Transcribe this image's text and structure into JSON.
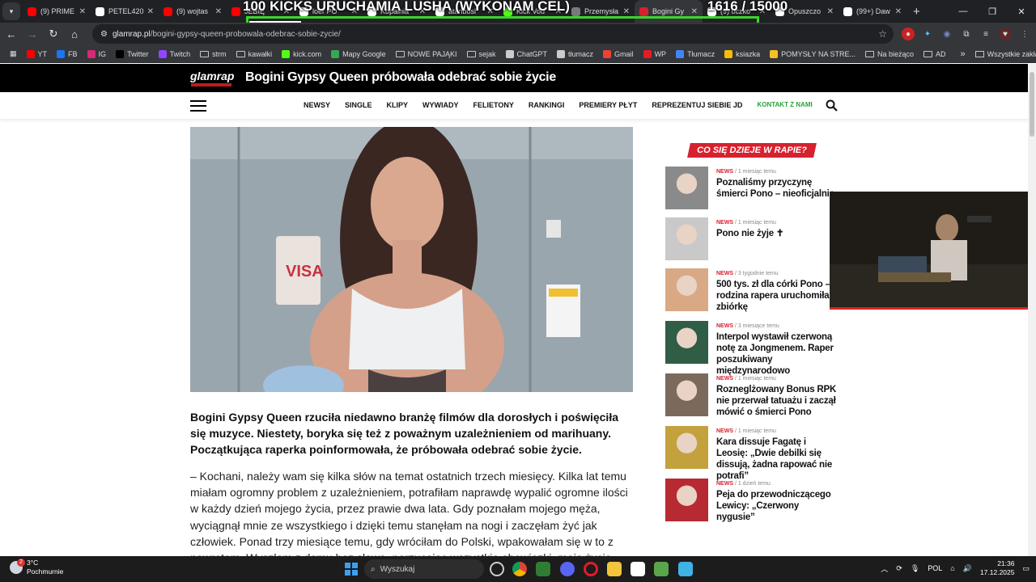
{
  "browser": {
    "tabs": [
      {
        "label": "(9) PRIME",
        "color": "#ff0000"
      },
      {
        "label": "PETEL420",
        "color": "#ffffff"
      },
      {
        "label": "(9) wojtas",
        "color": "#ff0000"
      },
      {
        "label": "JEBIĘ",
        "color": "#ff0000"
      },
      {
        "label": "loer PO",
        "color": "#ffffff"
      },
      {
        "label": "Kopalnia",
        "color": "#ffffff"
      },
      {
        "label": "atanbosl",
        "color": "#ffffff"
      },
      {
        "label": "Kick Vod",
        "color": "#53fc18"
      },
      {
        "label": "Przemysła",
        "color": "#7a7a7a"
      },
      {
        "label": "Bogini Gy",
        "color": "#d6212f",
        "active": true
      },
      {
        "label": "(9) oczko",
        "color": "#ffffff"
      },
      {
        "label": "Opuszczo",
        "color": "#ffffff"
      },
      {
        "label": "(99+) Daw",
        "color": "#ffffff"
      }
    ],
    "overlay_text_left": "100 KICKS URUCHAMIA LUSHA (WYKONAM CEL)",
    "overlay_text_right": "1616  / 15000",
    "url_host": "glamrap.pl",
    "url_path": "/bogini-gypsy-queen-probowala-odebrac-sobie-zycie/",
    "bookmarks": [
      {
        "label": "YT",
        "color": "#ff0000",
        "type": "icon"
      },
      {
        "label": "FB",
        "color": "#1877f2",
        "type": "icon"
      },
      {
        "label": "IG",
        "color": "#d62976",
        "type": "icon"
      },
      {
        "label": "Twitter",
        "color": "#000000",
        "type": "icon"
      },
      {
        "label": "Twitch",
        "color": "#9146ff",
        "type": "icon"
      },
      {
        "label": "strm",
        "type": "folder"
      },
      {
        "label": "kawałki",
        "type": "folder"
      },
      {
        "label": "kick.com",
        "color": "#53fc18",
        "type": "icon"
      },
      {
        "label": "Mapy Google",
        "color": "#34a853",
        "type": "icon"
      },
      {
        "label": "NOWE PAJĄKI",
        "type": "folder"
      },
      {
        "label": "sejak",
        "type": "folder"
      },
      {
        "label": "ChatGPT",
        "color": "#cccccc",
        "type": "icon"
      },
      {
        "label": "tłumacz",
        "color": "#cccccc",
        "type": "icon"
      },
      {
        "label": "Gmail",
        "color": "#ea4335",
        "type": "icon"
      },
      {
        "label": "WP",
        "color": "#e31b23",
        "type": "icon"
      },
      {
        "label": "Tłumacz",
        "color": "#4285f4",
        "type": "icon"
      },
      {
        "label": "ksiazka",
        "color": "#fbbc05",
        "type": "icon"
      },
      {
        "label": "POMYSŁY NA STRE...",
        "color": "#f6c026",
        "type": "icon"
      },
      {
        "label": "Na bieżąco",
        "type": "folder"
      },
      {
        "label": "AD",
        "type": "folder"
      }
    ],
    "bookmarks_other": "Wszystkie zakładki"
  },
  "site": {
    "logo": "glamrap",
    "headline": "Bogini Gypsy Queen próbowała odebrać sobie życie",
    "nav": [
      "NEWSY",
      "SINGLE",
      "KLIPY",
      "WYWIADY",
      "FELIETONY",
      "RANKINGI",
      "PREMIERY PŁYT",
      "REPREZENTUJ SIEBIE JD"
    ],
    "nav_contact": "KONTAKT Z NAMI",
    "lead": "Bogini Gypsy Queen rzuciła niedawno branżę filmów dla dorosłych i poświęciła się muzyce. Niestety, boryka się też z poważnym uzależnieniem od marihuany. Początkująca raperka poinformowała, że próbowała odebrać sobie życie.",
    "body": "– Kochani, należy wam się kilka słów na temat ostatnich trzech miesięcy. Kilka lat temu miałam ogromny problem z uzależnieniem, potrafiłam naprawdę wypalić ogromne ilości w każdy dzień mojego życia, przez prawie dwa lata. Gdy poznałam mojego męża, wyciągnął mnie ze wszystkiego i dzięki temu stanęłam na nogi i zaczęłam żyć jak człowiek. Ponad trzy miesiące temu, gdy wróciłam do Polski, wpakowałam się w to z powrotem. Wyszłam z domu bez słowa, porzucając wszystkie obowiązki, moje życie.",
    "sidebar_heading": "CO SIĘ DZIEJE W RAPIE?",
    "sidebar": [
      {
        "cat": "NEWS",
        "time": "1 miesiąc temu",
        "title": "Poznaliśmy przyczynę śmierci Pono – nieoficjalnie",
        "thumb": "#8a8a8a"
      },
      {
        "cat": "NEWS",
        "time": "1 miesiąc temu",
        "title": "Pono nie żyje ✝",
        "thumb": "#c9c9c9"
      },
      {
        "cat": "NEWS",
        "time": "3 tygodnie temu",
        "title": "500 tys. zł dla córki Pono – rodzina rapera uruchomiła zbiórkę",
        "thumb": "#d9a884"
      },
      {
        "cat": "NEWS",
        "time": "3 miesiące temu",
        "title": "Interpol wystawił czerwoną notę za Jongmenem. Raper poszukiwany międzynarodowo",
        "thumb": "#2f5d46"
      },
      {
        "cat": "NEWS",
        "time": "1 miesiąc temu",
        "title": "Rozneglżowany Bonus RPK nie przerwał tatuażu i zaczął mówić o śmierci Pono",
        "thumb": "#7b6a5c"
      },
      {
        "cat": "NEWS",
        "time": "1 miesiąc temu",
        "title": "Kara dissuje Fagatę i Leosię: „Dwie debilki się dissują, żadna rapować nie potrafi”",
        "thumb": "#c3a13c"
      },
      {
        "cat": "NEWS",
        "time": "1 dzień temu",
        "title": "Peja do przewodniczącego Lewicy: „Czerwony nygusie”",
        "thumb": "#b82a32"
      }
    ]
  },
  "taskbar": {
    "temp": "3°C",
    "weather": "Pochmurnie",
    "badge": "2",
    "search": "Wyszukaj",
    "lang": "POL",
    "time": "21:36",
    "date": "17.12.2025"
  }
}
